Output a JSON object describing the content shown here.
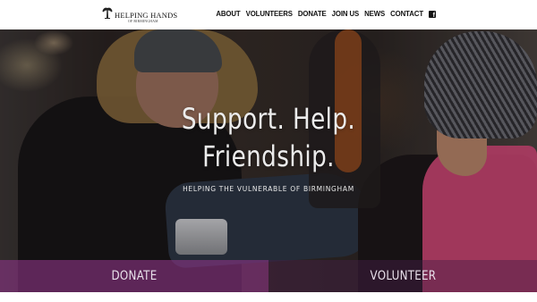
{
  "brand": {
    "title": "HELPING HANDS",
    "subtitle": "OF BIRMINGHAM"
  },
  "nav": {
    "items": [
      "ABOUT",
      "VOLUNTEERS",
      "DONATE",
      "JOIN US",
      "NEWS",
      "CONTACT"
    ],
    "social_icon": "facebook-icon"
  },
  "hero": {
    "title_line1": "Support. Help.",
    "title_line2": "Friendship.",
    "subtitle": "HELPING THE VULNERABLE OF BIRMINGHAM"
  },
  "cta": {
    "donate_label": "DONATE",
    "volunteer_label": "VOLUNTEER",
    "donate_color": "#8a3484",
    "volunteer_color": "#461e46"
  }
}
